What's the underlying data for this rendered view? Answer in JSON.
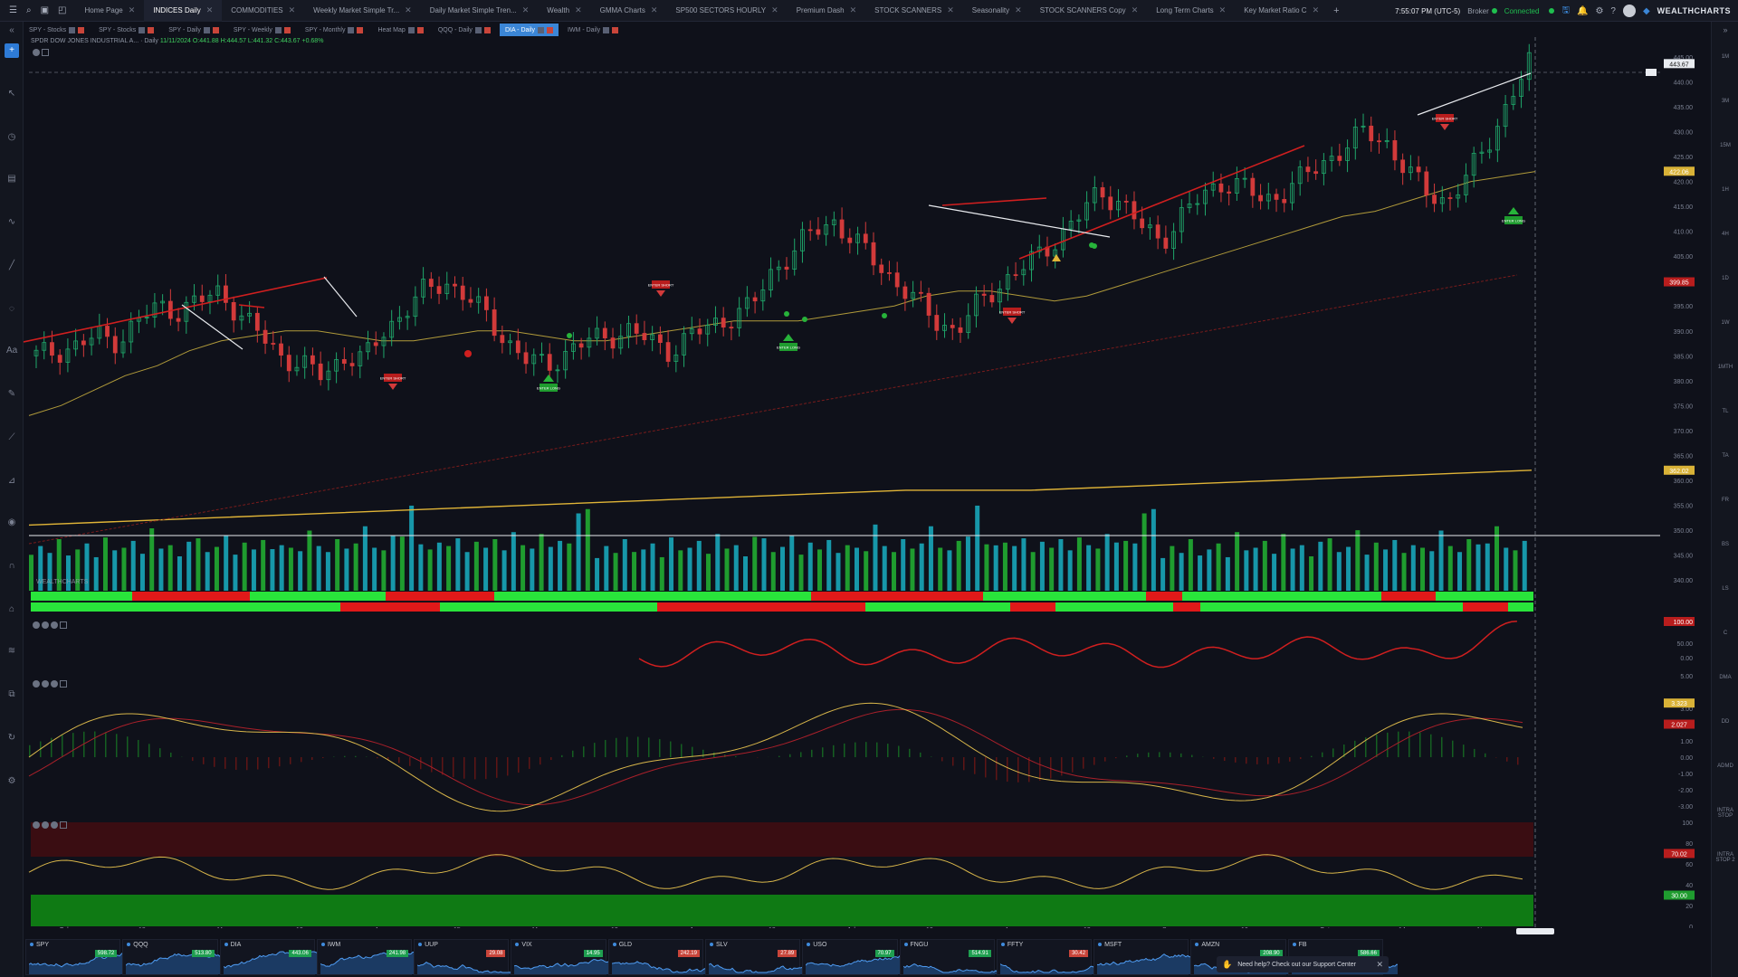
{
  "tabs": [
    {
      "label": "Home Page",
      "active": false
    },
    {
      "label": "INDICES Daily",
      "active": true
    },
    {
      "label": "COMMODITIES",
      "active": false
    },
    {
      "label": "Weekly Market Simple Tr...",
      "active": false
    },
    {
      "label": "Daily Market Simple Tren...",
      "active": false
    },
    {
      "label": "Wealth",
      "active": false
    },
    {
      "label": "GMMA Charts",
      "active": false
    },
    {
      "label": "SP500 SECTORS HOURLY",
      "active": false
    },
    {
      "label": "Premium Dash",
      "active": false
    },
    {
      "label": "STOCK SCANNERS",
      "active": false
    },
    {
      "label": "Seasonality",
      "active": false
    },
    {
      "label": "STOCK SCANNERS Copy",
      "active": false
    },
    {
      "label": "Long Term Charts",
      "active": false
    },
    {
      "label": "Key Market Ratio C",
      "active": false
    }
  ],
  "topbar": {
    "time": "7:55:07 PM (UTC-5)",
    "broker_label": "Broker",
    "connection": "Connected",
    "brand": "WEALTHCHARTS"
  },
  "subtabs": [
    {
      "label": "SPY - Stocks",
      "active": false
    },
    {
      "label": "SPY - Stocks",
      "active": false
    },
    {
      "label": "SPY - Daily",
      "active": false
    },
    {
      "label": "SPY - Weekly",
      "active": false
    },
    {
      "label": "SPY - Monthly",
      "active": false
    },
    {
      "label": "Heat Map",
      "active": false
    },
    {
      "label": "QQQ - Daily",
      "active": false
    },
    {
      "label": "DIA - Daily",
      "active": true
    },
    {
      "label": "IWM - Daily",
      "active": false
    }
  ],
  "legend": {
    "title": "SPDR DOW JONES INDUSTRIAL A... · Daily",
    "ohlc": "11/11/2024 O:441.88 H:444.57 L:441.32 C:443.67 +0.68%"
  },
  "watermark": "WEALTHCHARTS",
  "signals": {
    "enter_short": "ENTER SHORT",
    "enter_long": "ENTER LONG"
  },
  "chart_data": {
    "type": "candlestick",
    "symbol": "DIA",
    "interval": "Daily",
    "months": [
      "Feb",
      "13",
      "Mar",
      "13",
      "Apr",
      "15",
      "May",
      "13",
      "Jun",
      "13",
      "Jul",
      "12",
      "Aug",
      "13",
      "Sep",
      "16",
      "Oct",
      "14",
      "Nov"
    ],
    "price_axis": [
      "445.00",
      "440.00",
      "435.00",
      "430.00",
      "425.00",
      "420.00",
      "415.00",
      "410.00",
      "405.00",
      "400.00",
      "395.00",
      "390.00",
      "385.00",
      "380.00",
      "375.00",
      "370.00",
      "365.00",
      "360.00",
      "355.00",
      "350.00",
      "345.00",
      "340.00"
    ],
    "price_labels": [
      {
        "value": "443.67",
        "color": "#e9ecf1"
      },
      {
        "value": "422.06",
        "color": "#d9b237"
      },
      {
        "value": "399.85",
        "color": "#b81d1d"
      },
      {
        "value": "362.02",
        "color": "#d9b237"
      }
    ],
    "close_path": [
      385,
      386,
      387,
      389,
      388,
      392,
      395,
      394,
      396,
      398,
      393,
      389,
      385,
      383,
      381,
      385,
      384,
      390,
      394,
      398,
      400,
      397,
      393,
      388,
      384,
      383,
      386,
      388,
      389,
      390,
      388,
      386,
      389,
      391,
      393,
      395,
      402,
      406,
      410,
      412,
      408,
      404,
      400,
      396,
      392,
      390,
      395,
      399,
      402,
      405,
      409,
      413,
      418,
      416,
      411,
      408,
      413,
      417,
      420,
      419,
      416,
      418,
      421,
      424,
      427,
      430,
      428,
      422,
      418,
      416,
      421,
      428,
      436,
      443.67
    ],
    "ma_mid": [
      373,
      375,
      378,
      381,
      383,
      386,
      388,
      389,
      390,
      390,
      389,
      388,
      388,
      389,
      390,
      390,
      389,
      388,
      388,
      389,
      390,
      391,
      392,
      392,
      392,
      393,
      394,
      395,
      397,
      398,
      398,
      397,
      396,
      397,
      399,
      401,
      403,
      405,
      407,
      409,
      411,
      413,
      414,
      416,
      418,
      420,
      421,
      422
    ],
    "ma_200": [
      351,
      352,
      353,
      354,
      355,
      356,
      357,
      358,
      358,
      359,
      360,
      361,
      362.02
    ],
    "volume_heights": [
      0.38,
      0.52,
      0.44,
      0.6,
      0.41,
      0.48,
      0.55,
      0.39,
      0.62,
      0.47,
      0.5,
      0.58,
      0.43,
      0.66,
      0.49,
      0.53,
      0.4,
      0.57,
      0.61,
      0.45,
      0.51,
      0.64,
      0.42,
      0.56,
      0.48,
      0.59,
      0.44,
      0.53,
      0.5,
      0.46,
      0.7,
      0.52,
      0.45,
      0.6,
      0.49,
      0.55,
      0.75,
      0.5,
      0.47,
      0.58,
      0.63,
      0.99,
      0.54,
      0.48,
      0.56,
      0.52,
      0.61,
      0.45,
      0.57,
      0.5,
      0.6,
      0.47,
      0.62,
      0.53,
      0.49,
      0.66,
      0.51,
      0.58,
      0.55,
      0.9,
      0.95
    ],
    "volume_axis": [
      "0.00",
      "50.00"
    ],
    "osc1_axis": [
      "100.00",
      "50.00",
      "0.00"
    ],
    "macd_axis": [
      "5.00",
      "3.00",
      "2.00",
      "1.00",
      "0.00",
      "-1.00",
      "-2.00",
      "-3.00"
    ],
    "macd_labels": [
      "3.323",
      "2.027"
    ],
    "rsi_axis": [
      "100",
      "80",
      "60",
      "40",
      "20",
      "0"
    ],
    "rsi_labels": [
      "70.02",
      "30.00"
    ]
  },
  "pane_labels": [
    "1M",
    "3M",
    "15M",
    "1H",
    "4H",
    "1D",
    "1W",
    "1MTH",
    "TL",
    "TA",
    "FR",
    "BS",
    "LS",
    "C",
    "DMA",
    "DD",
    "ADMD",
    "INTRA STOP",
    "INTRA STOP 2"
  ],
  "watchlist": [
    {
      "symbol": "SPY",
      "price": "598.72",
      "up": true
    },
    {
      "symbol": "QQQ",
      "price": "513.80",
      "up": true
    },
    {
      "symbol": "DIA",
      "price": "443.06",
      "up": true
    },
    {
      "symbol": "IWM",
      "price": "241.98",
      "up": true
    },
    {
      "symbol": "UUP",
      "price": "29.08",
      "up": false
    },
    {
      "symbol": "VIX",
      "price": "14.95",
      "up": true
    },
    {
      "symbol": "GLD",
      "price": "242.19",
      "up": false
    },
    {
      "symbol": "SLV",
      "price": "27.89",
      "up": false
    },
    {
      "symbol": "USO",
      "price": "70.97",
      "up": true
    },
    {
      "symbol": "FNGU",
      "price": "514.91",
      "up": true
    },
    {
      "symbol": "FFTY",
      "price": "30.42",
      "up": false
    },
    {
      "symbol": "MSFT",
      "price": "",
      "up": true
    },
    {
      "symbol": "AMZN",
      "price": "208.90",
      "up": true
    },
    {
      "symbol": "FB",
      "price": "586.66",
      "up": true
    }
  ],
  "support_banner": "Need help? Check out our Support Center"
}
